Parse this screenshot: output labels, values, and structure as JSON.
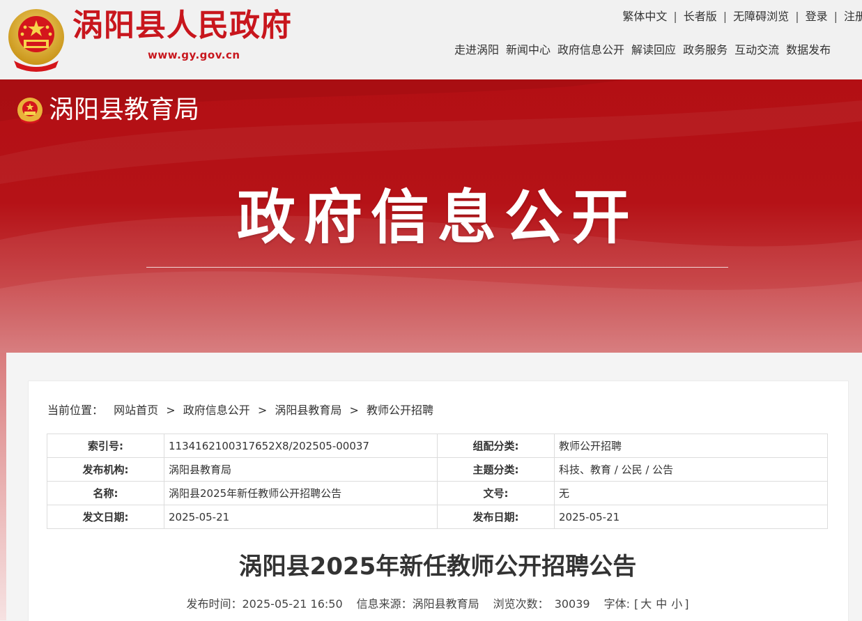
{
  "header": {
    "site_name": "涡阳县人民政府",
    "site_url": "www.gy.gov.cn",
    "util_links": [
      "繁体中文",
      "长者版",
      "无障碍浏览",
      "登录",
      "注册"
    ],
    "nav": [
      "走进涡阳",
      "新闻中心",
      "政府信息公开",
      "解读回应",
      "政务服务",
      "互动交流",
      "数据发布"
    ]
  },
  "banner": {
    "dept_name": "涡阳县教育局",
    "title": "政府信息公开"
  },
  "breadcrumb": {
    "label": "当前位置：",
    "items": [
      "网站首页",
      "政府信息公开",
      "涡阳县教育局",
      "教师公开招聘"
    ],
    "separator": ">"
  },
  "meta_table": {
    "rows": [
      {
        "k1": "索引号:",
        "v1": "1134162100317652X8/202505-00037",
        "k2": "组配分类:",
        "v2": "教师公开招聘"
      },
      {
        "k1": "发布机构:",
        "v1": "涡阳县教育局",
        "k2": "主题分类:",
        "v2": "科技、教育 / 公民 / 公告"
      },
      {
        "k1": "名称:",
        "v1": "涡阳县2025年新任教师公开招聘公告",
        "k2": "文号:",
        "v2": "无"
      },
      {
        "k1": "发文日期:",
        "v1": "2025-05-21",
        "k2": "发布日期:",
        "v2": "2025-05-21"
      }
    ]
  },
  "article": {
    "title": "涡阳县2025年新任教师公开招聘公告",
    "publish_time_label": "发布时间：",
    "publish_time": "2025-05-21 16:50",
    "source_label": "信息来源：",
    "source": "涡阳县教育局",
    "views_label": "浏览次数：",
    "views": "30039",
    "font_label": "字体:",
    "font_open": "[",
    "font_sizes": [
      "大",
      "中",
      "小"
    ],
    "font_close": "]"
  },
  "colors": {
    "brand_red": "#c8161d",
    "banner_red": "#b30f14"
  },
  "icons": [
    "national-emblem-icon"
  ]
}
